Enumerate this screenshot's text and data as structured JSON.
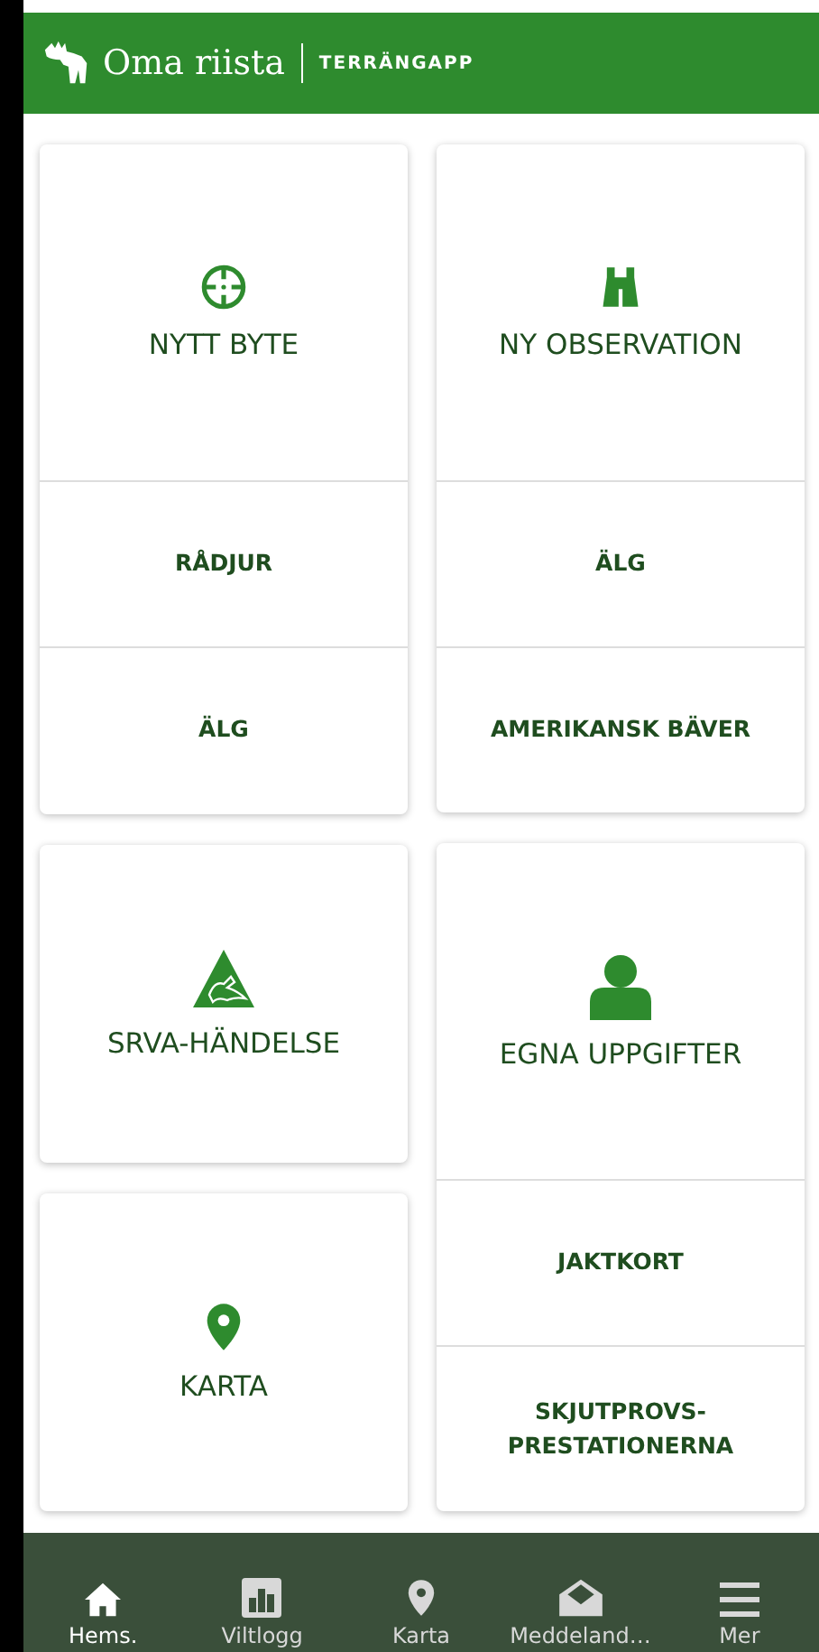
{
  "header": {
    "brand": "Oma riista",
    "subtitle": "TERRÄNGAPP"
  },
  "columns": [
    [
      {
        "label": "NYTT BYTE",
        "kind": "crosshair",
        "subs": [
          "RÅDJUR",
          "ÄLG"
        ]
      },
      {
        "label": "SRVA-HÄNDELSE",
        "kind": "srva"
      },
      {
        "label": "KARTA",
        "kind": "pin"
      }
    ],
    [
      {
        "label": "NY OBSERVATION",
        "kind": "binoculars",
        "subs": [
          "ÄLG",
          "AMERIKANSK BÄVER"
        ]
      },
      {
        "label": "EGNA UPPGIFTER",
        "kind": "person",
        "subs": [
          "JAKTKORT",
          "SKJUTPROVS-PRESTATIONERNA"
        ]
      }
    ]
  ],
  "nav": [
    {
      "label": "Hems.",
      "kind": "home",
      "selected": true
    },
    {
      "label": "Viltlogg",
      "kind": "chart",
      "selected": false
    },
    {
      "label": "Karta",
      "kind": "pin",
      "selected": false
    },
    {
      "label": "Meddeland…",
      "kind": "mail",
      "selected": false
    },
    {
      "label": "Mer",
      "kind": "menu",
      "selected": false
    }
  ]
}
